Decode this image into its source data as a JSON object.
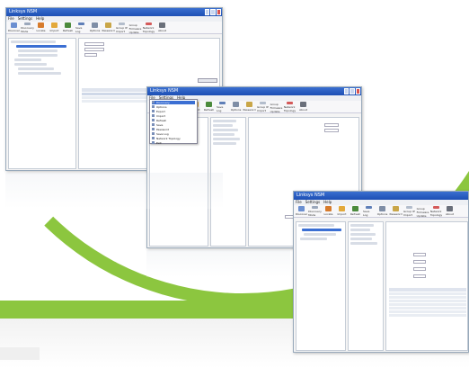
{
  "windows": [
    {
      "title": "Linksys NSM",
      "menu": [
        "File",
        "Settings",
        "Help"
      ],
      "toolbar": [
        "Discover",
        "Discovery Mode",
        "Locate",
        "Import",
        "Refresh",
        "Save Log",
        "Options",
        "Password",
        "Group IP Import",
        "Group Firmware Update",
        "Network Topology",
        "About"
      ]
    },
    {
      "title": "Linksys NSM",
      "menu": [
        "File",
        "Settings",
        "Help"
      ],
      "toolbar": [
        "Discover",
        "Discovery Mode",
        "Locate",
        "Import",
        "Refresh",
        "Save Log",
        "Options",
        "Password",
        "Group IP Import",
        "Group Firmware Update",
        "Network Topology",
        "About"
      ],
      "context_menu": [
        "Discovery",
        "Options",
        "Export",
        "Import",
        "Refresh",
        "Save",
        "Password",
        "Save Log",
        "Network Topology",
        "Exit"
      ]
    },
    {
      "title": "Linksys NSM",
      "menu": [
        "File",
        "Settings",
        "Help"
      ],
      "toolbar": [
        "Discover",
        "Discovery Mode",
        "Locate",
        "Import",
        "Refresh",
        "Save Log",
        "Options",
        "Password",
        "Group IP Import",
        "Group Firmware Update",
        "Network Topology",
        "About"
      ]
    }
  ],
  "colors": {
    "accent_green": "#8cc63f",
    "titlebar_blue": "#1d4fb4",
    "selection": "#3b6fd3"
  }
}
